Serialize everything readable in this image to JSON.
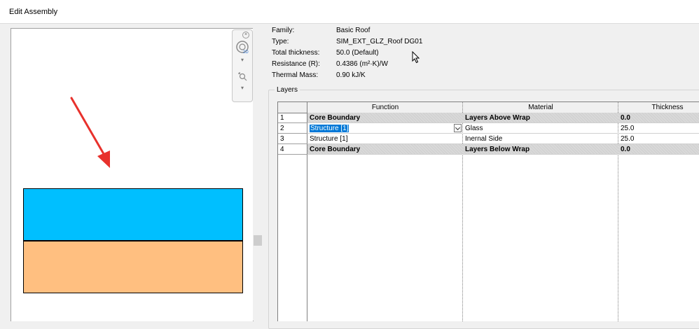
{
  "window": {
    "title": "Edit Assembly"
  },
  "properties": [
    {
      "label": "Family:",
      "value": "Basic Roof"
    },
    {
      "label": "Type:",
      "value": "SIM_EXT_GLZ_Roof DG01"
    },
    {
      "label": "Total thickness:",
      "value": "50.0 (Default)"
    },
    {
      "label": "Resistance (R):",
      "value": "0.4386 (m²·K)/W"
    },
    {
      "label": "Thermal Mass:",
      "value": "0.90 kJ/K"
    }
  ],
  "layers": {
    "group_label": "Layers",
    "columns": [
      "Function",
      "Material",
      "Thickness"
    ],
    "rows": [
      {
        "num": "1",
        "function": "Core Boundary",
        "material": "Layers Above Wrap",
        "thickness": "0.0",
        "boundary": true
      },
      {
        "num": "2",
        "function": "Structure [1]",
        "material": "Glass",
        "thickness": "25.0",
        "selected": true
      },
      {
        "num": "3",
        "function": "Structure [1]",
        "material": "Inernal Side",
        "thickness": "25.0"
      },
      {
        "num": "4",
        "function": "Core Boundary",
        "material": "Layers Below Wrap",
        "thickness": "0.0",
        "boundary": true
      }
    ]
  },
  "preview": {
    "layer_colors": {
      "top": "#00bfff",
      "bottom": "#ffbf80"
    },
    "annotation_color": "#e8312c"
  },
  "icons": [
    "close-icon",
    "zoom-2d-icon",
    "pan-zoom-icon",
    "arrow-annotation-icon",
    "mouse-cursor-icon",
    "dropdown-icon"
  ]
}
